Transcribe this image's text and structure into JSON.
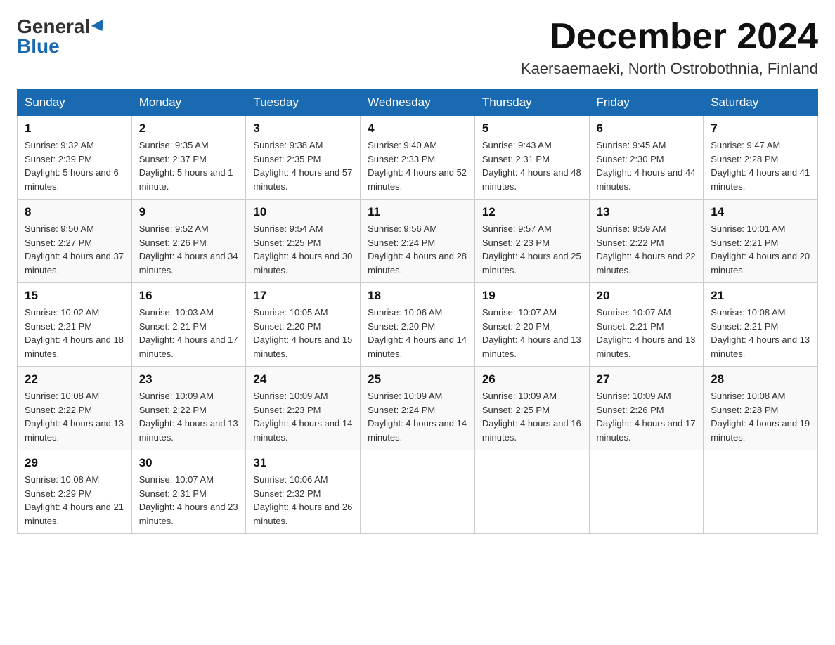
{
  "header": {
    "logo_general": "General",
    "logo_blue": "Blue",
    "month_title": "December 2024",
    "location": "Kaersaemaeki, North Ostrobothnia, Finland"
  },
  "weekdays": [
    "Sunday",
    "Monday",
    "Tuesday",
    "Wednesday",
    "Thursday",
    "Friday",
    "Saturday"
  ],
  "weeks": [
    [
      {
        "day": "1",
        "sunrise": "9:32 AM",
        "sunset": "2:39 PM",
        "daylight": "5 hours and 6 minutes."
      },
      {
        "day": "2",
        "sunrise": "9:35 AM",
        "sunset": "2:37 PM",
        "daylight": "5 hours and 1 minute."
      },
      {
        "day": "3",
        "sunrise": "9:38 AM",
        "sunset": "2:35 PM",
        "daylight": "4 hours and 57 minutes."
      },
      {
        "day": "4",
        "sunrise": "9:40 AM",
        "sunset": "2:33 PM",
        "daylight": "4 hours and 52 minutes."
      },
      {
        "day": "5",
        "sunrise": "9:43 AM",
        "sunset": "2:31 PM",
        "daylight": "4 hours and 48 minutes."
      },
      {
        "day": "6",
        "sunrise": "9:45 AM",
        "sunset": "2:30 PM",
        "daylight": "4 hours and 44 minutes."
      },
      {
        "day": "7",
        "sunrise": "9:47 AM",
        "sunset": "2:28 PM",
        "daylight": "4 hours and 41 minutes."
      }
    ],
    [
      {
        "day": "8",
        "sunrise": "9:50 AM",
        "sunset": "2:27 PM",
        "daylight": "4 hours and 37 minutes."
      },
      {
        "day": "9",
        "sunrise": "9:52 AM",
        "sunset": "2:26 PM",
        "daylight": "4 hours and 34 minutes."
      },
      {
        "day": "10",
        "sunrise": "9:54 AM",
        "sunset": "2:25 PM",
        "daylight": "4 hours and 30 minutes."
      },
      {
        "day": "11",
        "sunrise": "9:56 AM",
        "sunset": "2:24 PM",
        "daylight": "4 hours and 28 minutes."
      },
      {
        "day": "12",
        "sunrise": "9:57 AM",
        "sunset": "2:23 PM",
        "daylight": "4 hours and 25 minutes."
      },
      {
        "day": "13",
        "sunrise": "9:59 AM",
        "sunset": "2:22 PM",
        "daylight": "4 hours and 22 minutes."
      },
      {
        "day": "14",
        "sunrise": "10:01 AM",
        "sunset": "2:21 PM",
        "daylight": "4 hours and 20 minutes."
      }
    ],
    [
      {
        "day": "15",
        "sunrise": "10:02 AM",
        "sunset": "2:21 PM",
        "daylight": "4 hours and 18 minutes."
      },
      {
        "day": "16",
        "sunrise": "10:03 AM",
        "sunset": "2:21 PM",
        "daylight": "4 hours and 17 minutes."
      },
      {
        "day": "17",
        "sunrise": "10:05 AM",
        "sunset": "2:20 PM",
        "daylight": "4 hours and 15 minutes."
      },
      {
        "day": "18",
        "sunrise": "10:06 AM",
        "sunset": "2:20 PM",
        "daylight": "4 hours and 14 minutes."
      },
      {
        "day": "19",
        "sunrise": "10:07 AM",
        "sunset": "2:20 PM",
        "daylight": "4 hours and 13 minutes."
      },
      {
        "day": "20",
        "sunrise": "10:07 AM",
        "sunset": "2:21 PM",
        "daylight": "4 hours and 13 minutes."
      },
      {
        "day": "21",
        "sunrise": "10:08 AM",
        "sunset": "2:21 PM",
        "daylight": "4 hours and 13 minutes."
      }
    ],
    [
      {
        "day": "22",
        "sunrise": "10:08 AM",
        "sunset": "2:22 PM",
        "daylight": "4 hours and 13 minutes."
      },
      {
        "day": "23",
        "sunrise": "10:09 AM",
        "sunset": "2:22 PM",
        "daylight": "4 hours and 13 minutes."
      },
      {
        "day": "24",
        "sunrise": "10:09 AM",
        "sunset": "2:23 PM",
        "daylight": "4 hours and 14 minutes."
      },
      {
        "day": "25",
        "sunrise": "10:09 AM",
        "sunset": "2:24 PM",
        "daylight": "4 hours and 14 minutes."
      },
      {
        "day": "26",
        "sunrise": "10:09 AM",
        "sunset": "2:25 PM",
        "daylight": "4 hours and 16 minutes."
      },
      {
        "day": "27",
        "sunrise": "10:09 AM",
        "sunset": "2:26 PM",
        "daylight": "4 hours and 17 minutes."
      },
      {
        "day": "28",
        "sunrise": "10:08 AM",
        "sunset": "2:28 PM",
        "daylight": "4 hours and 19 minutes."
      }
    ],
    [
      {
        "day": "29",
        "sunrise": "10:08 AM",
        "sunset": "2:29 PM",
        "daylight": "4 hours and 21 minutes."
      },
      {
        "day": "30",
        "sunrise": "10:07 AM",
        "sunset": "2:31 PM",
        "daylight": "4 hours and 23 minutes."
      },
      {
        "day": "31",
        "sunrise": "10:06 AM",
        "sunset": "2:32 PM",
        "daylight": "4 hours and 26 minutes."
      },
      null,
      null,
      null,
      null
    ]
  ]
}
